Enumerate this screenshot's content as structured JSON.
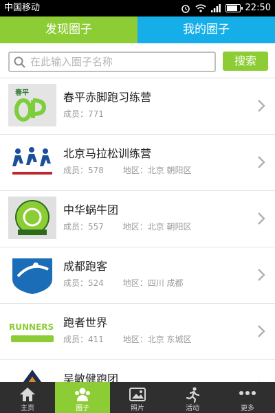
{
  "status_bar": {
    "carrier": "中国移动",
    "time": "22:50"
  },
  "tabs": [
    {
      "label": "发现圈子",
      "active": true
    },
    {
      "label": "我的圈子",
      "active": false
    }
  ],
  "search": {
    "placeholder": "在此输入圈子名称",
    "button_label": "搜索"
  },
  "circles": [
    {
      "name": "春平赤脚跑习练营",
      "members": "成员：771",
      "region": "",
      "logo_text": "春平"
    },
    {
      "name": "北京马拉松训练营",
      "members": "成员：578",
      "region": "地区：北京 朝阳区",
      "logo_text": ""
    },
    {
      "name": "中华蜗牛团",
      "members": "成员：557",
      "region": "地区：北京 朝阳区",
      "logo_text": ""
    },
    {
      "name": "成都跑客",
      "members": "成员：524",
      "region": "地区：四川 成都",
      "logo_text": ""
    },
    {
      "name": "跑者世界",
      "members": "成员：411",
      "region": "地区：北京 东城区",
      "logo_text": "RUNNERS"
    },
    {
      "name": "吴敏健跑团",
      "members": "",
      "region": "",
      "logo_text": ""
    }
  ],
  "bottom_nav": [
    {
      "label": "主页",
      "icon": "home-icon"
    },
    {
      "label": "圈子",
      "icon": "group-icon",
      "active": true
    },
    {
      "label": "照片",
      "icon": "photo-icon"
    },
    {
      "label": "活动",
      "icon": "runner-icon"
    },
    {
      "label": "更多",
      "icon": "more-icon"
    }
  ],
  "colors": {
    "green": "#8ccc34",
    "blue": "#16aee8",
    "nav_bg": "#2f2f2f"
  }
}
